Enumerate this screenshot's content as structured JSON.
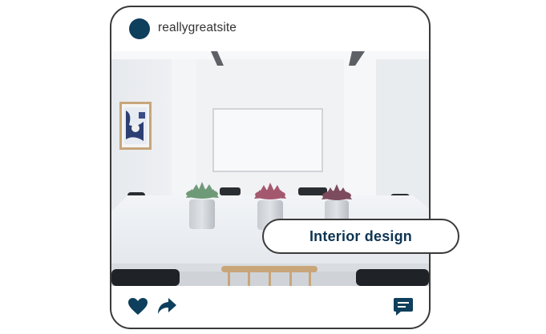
{
  "post": {
    "username": "reallygreatsite",
    "tag_label": "Interior design"
  },
  "icons": {
    "avatar": "avatar-circle",
    "like": "heart-icon",
    "share": "share-arrow-icon",
    "comment": "comment-bubble-icon"
  },
  "colors": {
    "accent": "#0e3f5c",
    "border": "#3a3a3a",
    "tag_text": "#0e3452"
  }
}
